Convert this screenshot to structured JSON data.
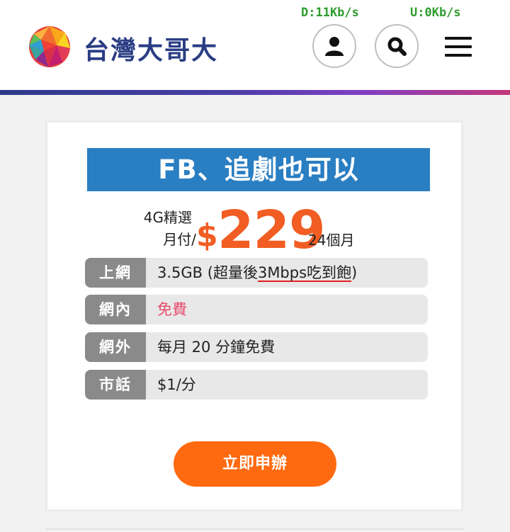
{
  "status": {
    "download": "D:11Kb/s",
    "upload": "U:0Kb/s"
  },
  "header": {
    "brand": "台灣大哥大",
    "user_icon": "user-icon",
    "search_icon": "search-icon",
    "menu_icon": "hamburger-menu-icon"
  },
  "colors": {
    "brand": "#2a3d84",
    "accent": "#f15d22",
    "banner": "#2a7ec2",
    "button": "#ff6a10"
  },
  "plan": {
    "title": "FB、追劇也可以",
    "type": "4G精選",
    "payment": "月付/",
    "currency": "$",
    "price": "229",
    "term": "24個月",
    "features": [
      {
        "label": "上網",
        "value_prefix": "3.5GB (超量後",
        "value_underline": "3Mbps吃到飽",
        "value_suffix": ")"
      },
      {
        "label": "網內",
        "value": "免費"
      },
      {
        "label": "網外",
        "value": "每月 20 分鐘免費"
      },
      {
        "label": "市話",
        "value": "$1/分"
      }
    ],
    "apply_label": "立即申辦"
  }
}
